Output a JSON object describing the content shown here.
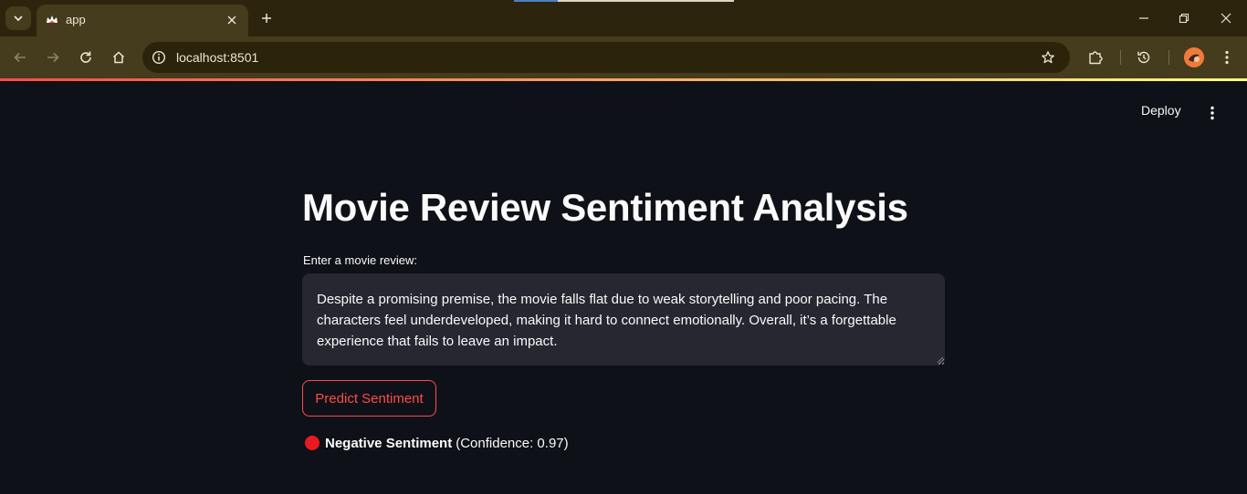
{
  "browser": {
    "tab_title": "app",
    "url": "localhost:8501"
  },
  "app": {
    "deploy_label": "Deploy",
    "title": "Movie Review Sentiment Analysis",
    "input_label": "Enter a movie review:",
    "review_text": "Despite a promising premise, the movie falls flat due to weak storytelling and poor pacing. The characters feel underdeveloped, making it hard to connect emotionally. Overall, it’s a forgettable experience that fails to leave an impact.",
    "predict_button": "Predict Sentiment",
    "result": {
      "icon": "red-circle-icon",
      "sentiment": "Negative Sentiment",
      "confidence_text": "(Confidence: 0.97)"
    }
  },
  "colors": {
    "app_background": "#0e1117",
    "accent": "#ff4b4b",
    "negative_dot": "#e8191f",
    "chrome_frame": "#453b1d"
  }
}
